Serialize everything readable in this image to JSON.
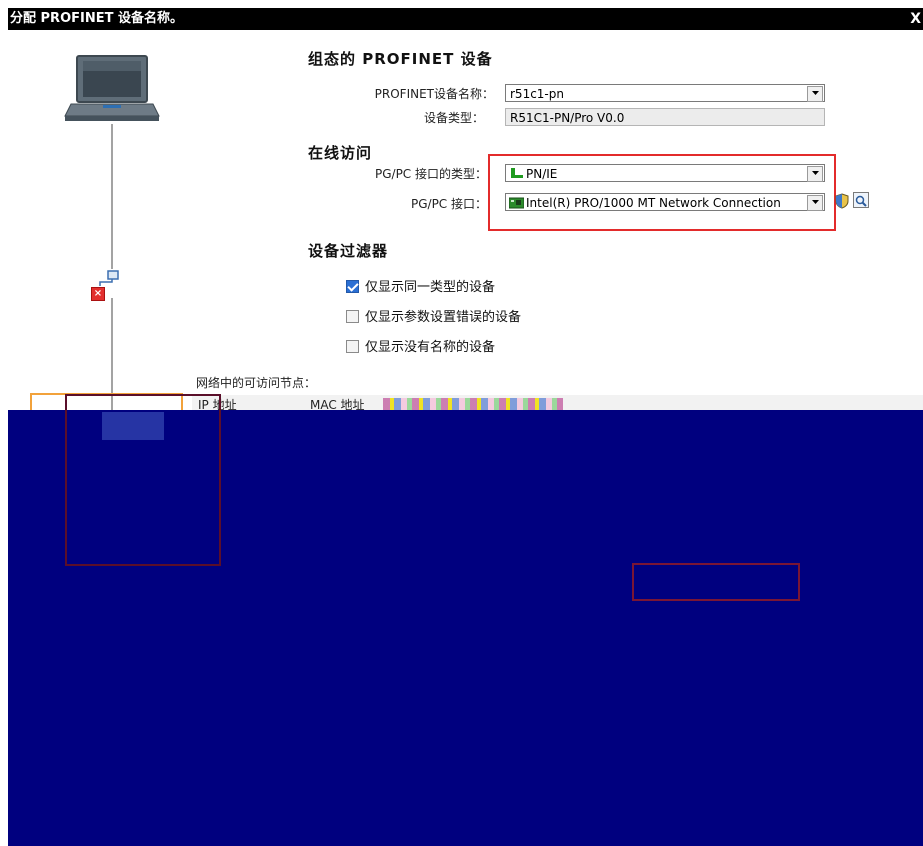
{
  "window": {
    "title": "分配 PROFINET 设备名称。",
    "close_label": "X"
  },
  "configured": {
    "heading": "组态的 PROFINET 设备",
    "name_label": "PROFINET设备名称：",
    "name_value": "r51c1-pn",
    "type_label": "设备类型：",
    "type_value": "R51C1-PN/Pro V0.0"
  },
  "online": {
    "heading": "在线访问",
    "iface_type_label": "PG/PC 接口的类型：",
    "iface_type_value": "PN/IE",
    "iface_label": "PG/PC 接口：",
    "iface_value": "Intel(R) PRO/1000 MT Network Connection"
  },
  "filter": {
    "heading": "设备过滤器",
    "options": [
      {
        "label": "仅显示同一类型的设备",
        "checked": true
      },
      {
        "label": "仅显示参数设置错误的设备",
        "checked": false
      },
      {
        "label": "仅显示没有名称的设备",
        "checked": false
      }
    ]
  },
  "nodes": {
    "label": "网络中的可访问节点：",
    "columns": [
      "IP 地址",
      "MAC 地址"
    ]
  },
  "icons": [
    "laptop-icon",
    "network-port-icon",
    "error-icon",
    "dropdown-arrow-icon",
    "ethernet-icon",
    "network-card-icon",
    "shield-icon",
    "search-icon"
  ],
  "colors": {
    "titlebar": "#000000",
    "highlight_box": "#e32b2b",
    "corrupted_area": "#00007f"
  }
}
